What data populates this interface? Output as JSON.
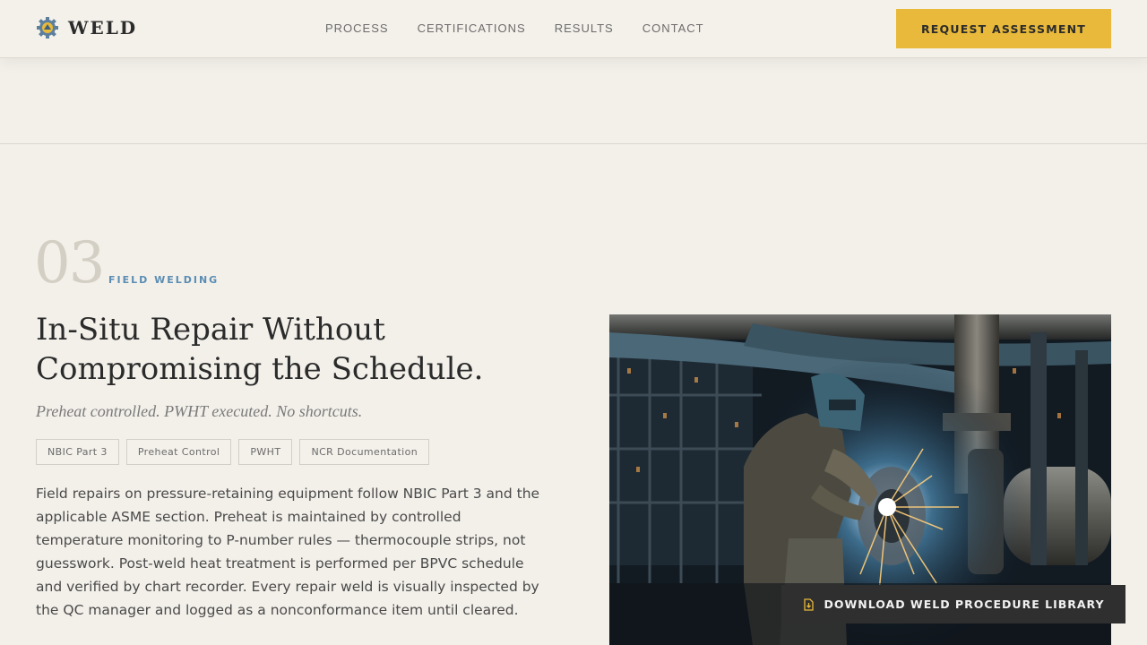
{
  "header": {
    "logo_text": "WELD",
    "nav": [
      "PROCESS",
      "CERTIFICATIONS",
      "RESULTS",
      "CONTACT"
    ],
    "cta_label": "REQUEST ASSESSMENT"
  },
  "section": {
    "number": "03",
    "eyebrow": "FIELD WELDING",
    "headline": "In-Situ Repair Without Compromising the Schedule.",
    "subhead": "Preheat controlled. PWHT executed. No shortcuts.",
    "tags": [
      "NBIC Part 3",
      "Preheat Control",
      "PWHT",
      "NCR Documentation"
    ],
    "body": "Field repairs on pressure-retaining equipment follow NBIC Part 3 and the applicable ASME section. Preheat is maintained by controlled temperature monitoring to P-number rules — thermocouple strips, not guesswork. Post-weld heat treatment is performed per BPVC schedule and verified by chart recorder. Every repair weld is visually inspected by the QC manager and logged as a nonconformance item until cleared.",
    "download_label": "DOWNLOAD WELD PROCEDURE LIBRARY"
  },
  "colors": {
    "accent": "#e8b93a",
    "background": "#f3f0ea",
    "eyebrow": "#5b8db3",
    "dark_button": "#2f2f2f"
  },
  "icons": {
    "logo": "gear-icon",
    "download": "document-download-icon"
  }
}
